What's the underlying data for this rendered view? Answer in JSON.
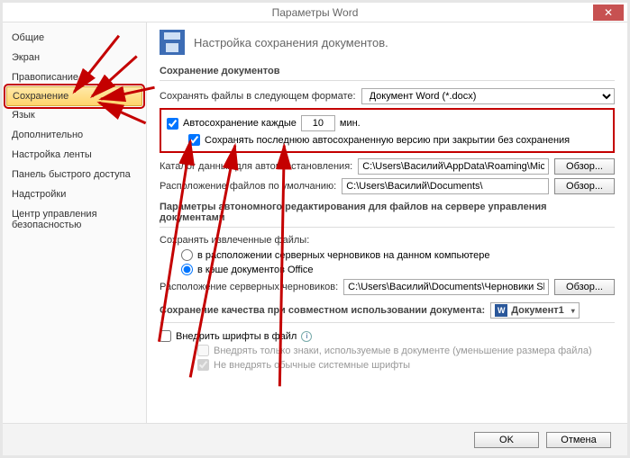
{
  "title": "Параметры Word",
  "close": "✕",
  "sidebar": {
    "items": [
      {
        "label": "Общие"
      },
      {
        "label": "Экран"
      },
      {
        "label": "Правописание"
      },
      {
        "label": "Сохранение",
        "selected": true
      },
      {
        "label": "Язык"
      },
      {
        "label": "Дополнительно"
      },
      {
        "label": "Настройка ленты"
      },
      {
        "label": "Панель быстрого доступа"
      },
      {
        "label": "Надстройки"
      },
      {
        "label": "Центр управления безопасностью"
      }
    ]
  },
  "header": "Настройка сохранения документов.",
  "groups": {
    "save_docs": {
      "title": "Сохранение документов",
      "format_label": "Сохранять файлы в следующем формате:",
      "format_value": "Документ Word (*.docx)",
      "autosave_label": "Автосохранение каждые",
      "autosave_value": "10",
      "autosave_unit": "мин.",
      "keep_last_label": "Сохранять последнюю автосохраненную версию при закрытии без сохранения",
      "autorecover_label": "Каталог данных для автовосстановления:",
      "autorecover_path": "C:\\Users\\Василий\\AppData\\Roaming\\Microsoft\\Word\\",
      "default_loc_label": "Расположение файлов по умолчанию:",
      "default_loc_path": "C:\\Users\\Василий\\Documents\\",
      "browse": "Обзор..."
    },
    "offline": {
      "title": "Параметры автономного редактирования для файлов на сервере управления документами",
      "save_checked_label": "Сохранять извлеченные файлы:",
      "opt1": "в расположении серверных черновиков на данном компьютере",
      "opt2": "в кэше документов Office",
      "drafts_label": "Расположение серверных черновиков:",
      "drafts_path": "C:\\Users\\Василий\\Documents\\Черновики SharePoint\\",
      "browse": "Обзор..."
    },
    "quality": {
      "title": "Сохранение качества при совместном использовании документа:",
      "doc": "Документ1",
      "embed": "Внедрить шрифты в файл",
      "embed_used": "Внедрять только знаки, используемые в документе (уменьшение размера файла)",
      "no_system": "Не внедрять обычные системные шрифты"
    }
  },
  "footer": {
    "ok": "OK",
    "cancel": "Отмена"
  }
}
